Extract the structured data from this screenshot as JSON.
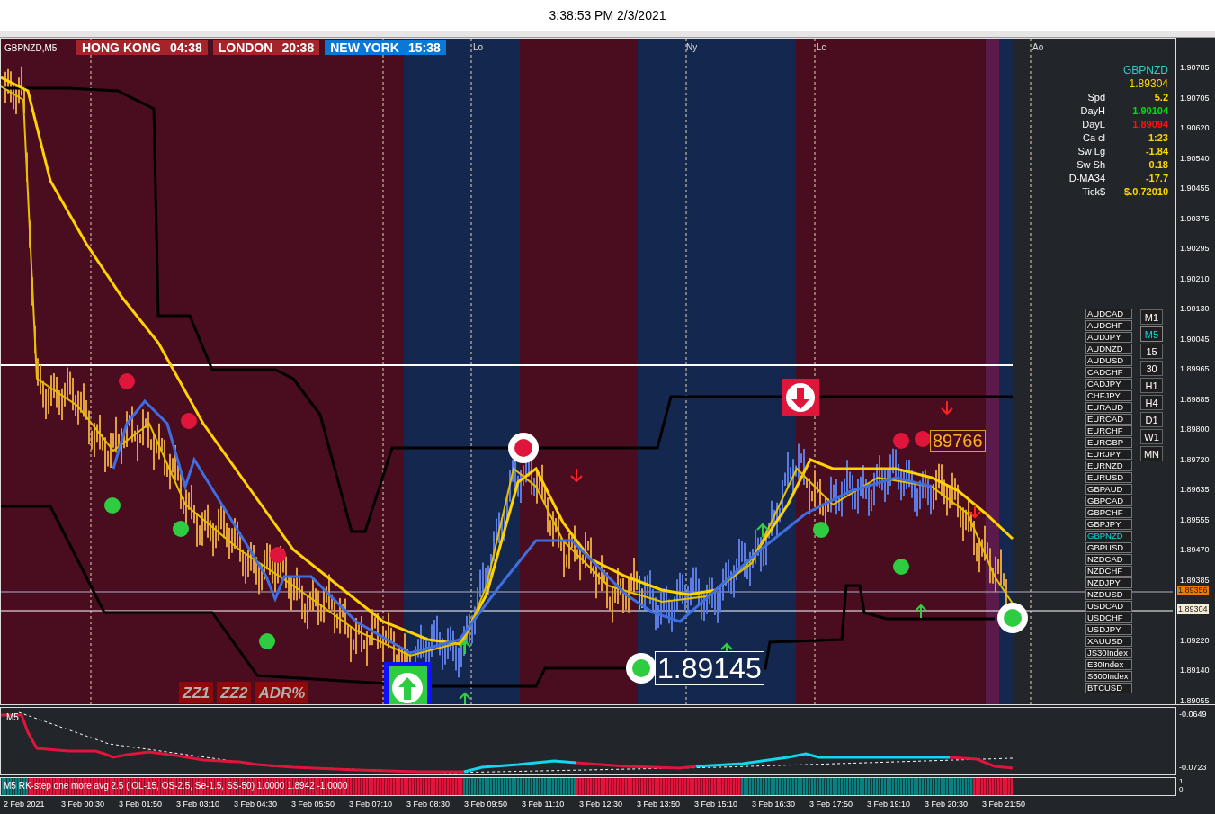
{
  "clock": "3:38:53 PM 2/3/2021",
  "chart": {
    "symbol_label": "GBPNZD,M5",
    "sessions": [
      {
        "name": "HONG KONG",
        "time": "04:38",
        "color": "#a5232a"
      },
      {
        "name": "LONDON",
        "time": "20:38",
        "color": "#a5232a"
      },
      {
        "name": "NEW YORK",
        "time": "15:38",
        "color": "#0a78d7"
      }
    ],
    "markers": [
      "Lo",
      "Ny",
      "Lc",
      "Ao"
    ],
    "info": {
      "symbol": "GBPNZD",
      "price": "1.89304",
      "rows": [
        {
          "label": "Spd",
          "value": "5.2",
          "color": "#ffd700"
        },
        {
          "label": "DayH",
          "value": "1.90104",
          "color": "#00e000"
        },
        {
          "label": "DayL",
          "value": "1.89094",
          "color": "#ff1010"
        },
        {
          "label": "Ca cl",
          "value": "1:23",
          "color": "#ffd700"
        },
        {
          "label": "Sw Lg",
          "value": "-1.84",
          "color": "#ffd700"
        },
        {
          "label": "Sw Sh",
          "value": "0.18",
          "color": "#ffd700"
        },
        {
          "label": "D-MA34",
          "value": "-17.7",
          "color": "#ffd700"
        },
        {
          "label": "Tick$",
          "value": "$.0.72010",
          "color": "#ffd700"
        }
      ]
    },
    "symbols": [
      {
        "label": "AUDCAD",
        "selected": false
      },
      {
        "label": "AUDCHF",
        "selected": false
      },
      {
        "label": "AUDJPY",
        "selected": false
      },
      {
        "label": "AUDNZD",
        "selected": false
      },
      {
        "label": "AUDUSD",
        "selected": false
      },
      {
        "label": "CADCHF",
        "selected": false
      },
      {
        "label": "CADJPY",
        "selected": false
      },
      {
        "label": "CHFJPY",
        "selected": false
      },
      {
        "label": "EURAUD",
        "selected": false
      },
      {
        "label": "EURCAD",
        "selected": false
      },
      {
        "label": "EURCHF",
        "selected": false
      },
      {
        "label": "EURGBP",
        "selected": false
      },
      {
        "label": "EURJPY",
        "selected": false
      },
      {
        "label": "EURNZD",
        "selected": false
      },
      {
        "label": "EURUSD",
        "selected": false
      },
      {
        "label": "GBPAUD",
        "selected": false
      },
      {
        "label": "GBPCAD",
        "selected": false
      },
      {
        "label": "GBPCHF",
        "selected": false
      },
      {
        "label": "GBPJPY",
        "selected": false
      },
      {
        "label": "GBPNZD",
        "selected": true
      },
      {
        "label": "GBPUSD",
        "selected": false
      },
      {
        "label": "NZDCAD",
        "selected": false
      },
      {
        "label": "NZDCHF",
        "selected": false
      },
      {
        "label": "NZDJPY",
        "selected": false
      },
      {
        "label": "NZDUSD",
        "selected": false
      },
      {
        "label": "USDCAD",
        "selected": false
      },
      {
        "label": "USDCHF",
        "selected": false
      },
      {
        "label": "USDJPY",
        "selected": false
      },
      {
        "label": "XAUUSD",
        "selected": false
      },
      {
        "label": "JS30Index",
        "selected": false
      },
      {
        "label": "E30Index",
        "selected": false
      },
      {
        "label": "S500Index",
        "selected": false
      },
      {
        "label": "BTCUSD",
        "selected": false
      }
    ],
    "timeframes": [
      {
        "label": "M1",
        "selected": false
      },
      {
        "label": "M5",
        "selected": true
      },
      {
        "label": "15",
        "selected": false
      },
      {
        "label": "30",
        "selected": false
      },
      {
        "label": "H1",
        "selected": false
      },
      {
        "label": "H4",
        "selected": false
      },
      {
        "label": "D1",
        "selected": false
      },
      {
        "label": "W1",
        "selected": false
      },
      {
        "label": "MN",
        "selected": false
      }
    ],
    "tool_buttons": [
      "ZZ1",
      "ZZ2",
      "ADR%"
    ],
    "price_label": "1.89145",
    "callout_price": "89766"
  },
  "price_axis": {
    "ticks": [
      "1.90785",
      "1.90705",
      "1.90620",
      "1.90540",
      "1.90455",
      "1.90375",
      "1.90295",
      "1.90210",
      "1.90130",
      "1.90045",
      "1.89965",
      "1.89885",
      "1.89800",
      "1.89720",
      "1.89635",
      "1.89555",
      "1.89470",
      "1.89385",
      "1.89220",
      "1.89140",
      "1.89055"
    ],
    "current": [
      {
        "value": "1.89356",
        "kind": "ask"
      },
      {
        "value": "1.89304",
        "kind": "bid"
      }
    ]
  },
  "indicator": {
    "label": "M5",
    "ticks": [
      "-0.0649",
      "-0.0723"
    ]
  },
  "strip": {
    "label": "M5 RK-step one more avg 2.5 ( OL-15, OS-2.5, Se-1.5, SS-50) 1.0000 1.8942 -1.0000",
    "ticks": [
      "1",
      "0"
    ]
  },
  "time_axis": [
    "2 Feb 2021",
    "3 Feb 00:30",
    "3 Feb 01:50",
    "3 Feb 03:10",
    "3 Feb 04:30",
    "3 Feb 05:50",
    "3 Feb 07:10",
    "3 Feb 08:30",
    "3 Feb 09:50",
    "3 Feb 11:10",
    "3 Feb 12:30",
    "3 Feb 13:50",
    "3 Feb 15:10",
    "3 Feb 16:30",
    "3 Feb 17:50",
    "3 Feb 19:10",
    "3 Feb 20:30",
    "3 Feb 21:50"
  ]
}
